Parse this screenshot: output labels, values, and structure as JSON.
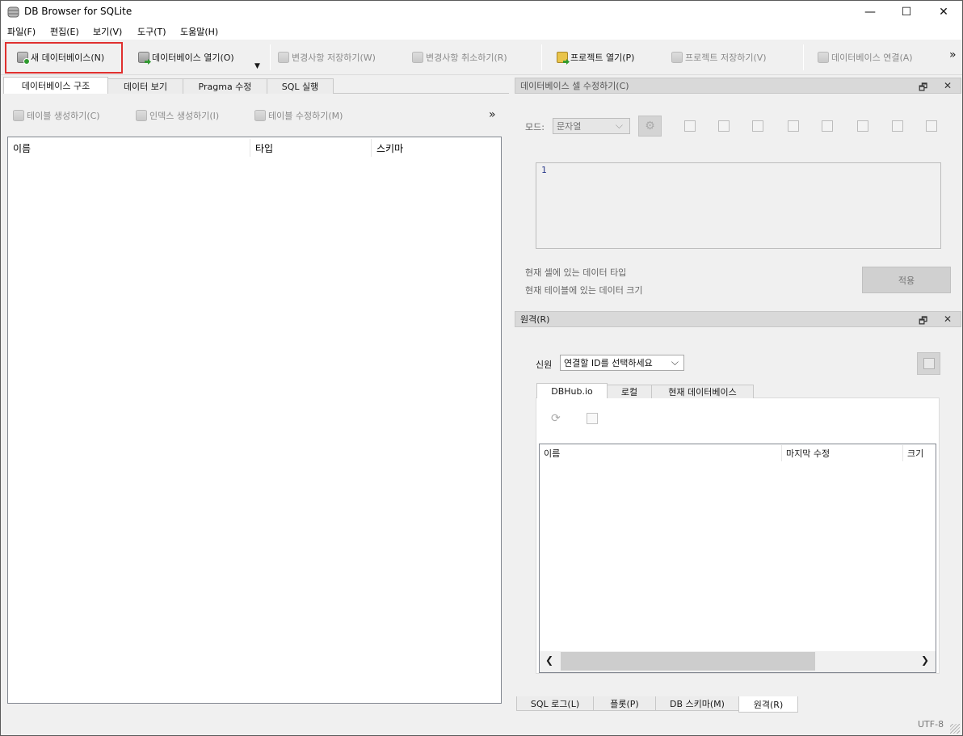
{
  "window": {
    "title": "DB Browser for SQLite",
    "minimize_glyph": "—",
    "maximize_glyph": "☐",
    "close_glyph": "✕"
  },
  "menu": [
    "파일(F)",
    "편집(E)",
    "보기(V)",
    "도구(T)",
    "도움말(H)"
  ],
  "toolbar": {
    "new_db": "새 데이터베이스(N)",
    "open_db": "데이터베이스 열기(O)",
    "write_changes": "변경사항 저장하기(W)",
    "revert_changes": "변경사항 취소하기(R)",
    "open_project": "프로젝트 열기(P)",
    "save_project": "프로젝트 저장하기(V)",
    "attach_db": "데이터베이스 연결(A)",
    "more": "»",
    "dropdown_glyph": "▼"
  },
  "left_tabs": [
    "데이터베이스 구조",
    "데이터 보기",
    "Pragma 수정",
    "SQL 실행"
  ],
  "structure_toolbar": {
    "create_table": "테이블 생성하기(C)",
    "create_index": "인덱스 생성하기(I)",
    "modify_table": "테이블 수정하기(M)",
    "more": "»"
  },
  "structure_columns": [
    "이름",
    "타입",
    "스키마"
  ],
  "edit_cell": {
    "title": "데이터베이스 셀 수정하기(C)",
    "mode_label": "모드:",
    "mode_value": "문자열",
    "line_number": "1",
    "type_label": "현재 셀에 있는 데이터 타입",
    "size_label": "현재 테이블에 있는 데이터 크기",
    "apply": "적용"
  },
  "remote": {
    "title": "원격(R)",
    "identity_label": "신원",
    "identity_value": "연결할 ID를 선택하세요",
    "tabs": [
      "DBHub.io",
      "로컬",
      "현재 데이터베이스"
    ],
    "columns": [
      "이름",
      "마지막 수정",
      "크기"
    ]
  },
  "dock_float_glyph": "🗗",
  "dock_close_glyph": "✕",
  "scroll_left": "❮",
  "scroll_right": "❯",
  "chevron": "⌵",
  "bottom_tabs": [
    "SQL 로그(L)",
    "플롯(P)",
    "DB 스키마(M)",
    "원격(R)"
  ],
  "status": {
    "encoding": "UTF-8"
  }
}
